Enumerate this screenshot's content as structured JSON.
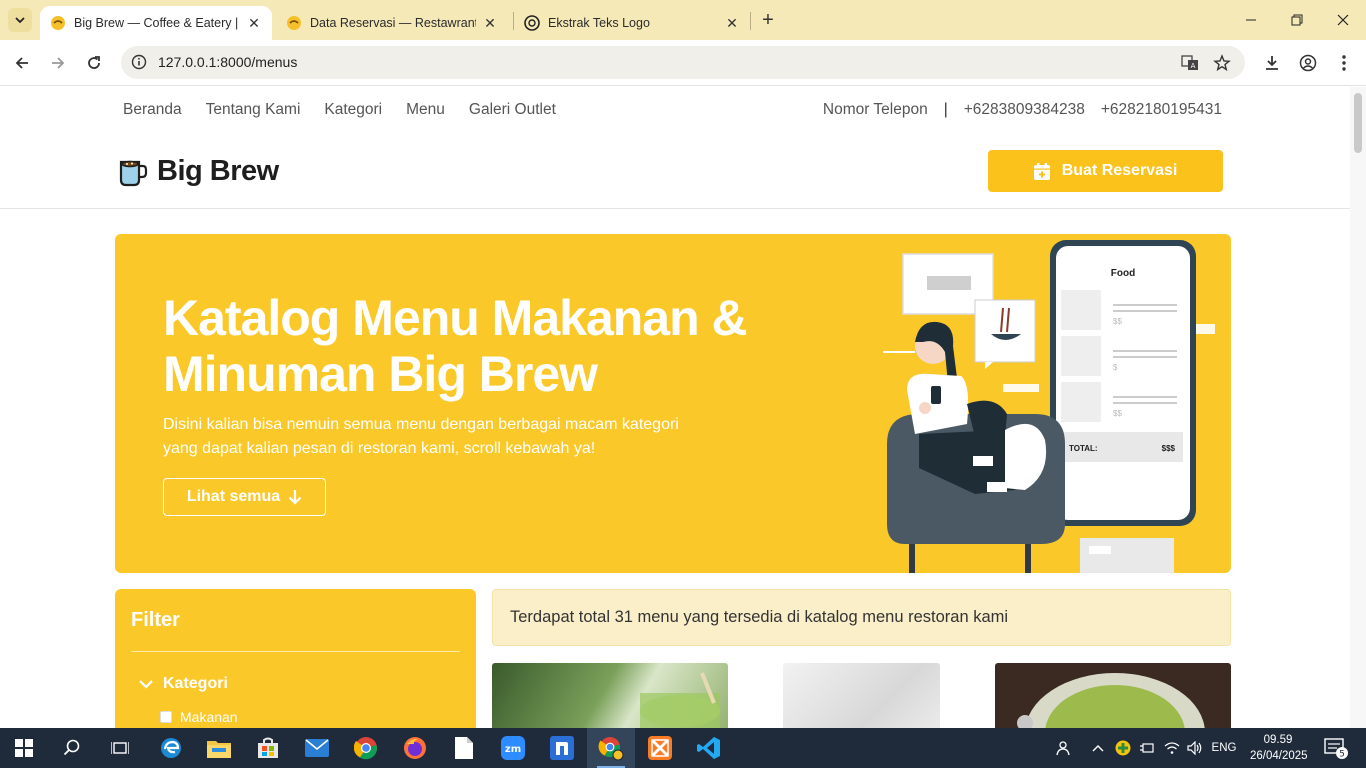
{
  "browser": {
    "tabs": [
      {
        "title": "Big Brew — Coffee & Eatery | R",
        "active": true
      },
      {
        "title": "Data Reservasi — Restawrant",
        "active": false
      },
      {
        "title": "Ekstrak Teks Logo",
        "active": false
      }
    ],
    "url": "127.0.0.1:8000/menus"
  },
  "site": {
    "nav": [
      "Beranda",
      "Tentang Kami",
      "Kategori",
      "Menu",
      "Galeri Outlet"
    ],
    "phone_label": "Nomor Telepon",
    "separator": "|",
    "phones": [
      "+6283809384238",
      "+6282180195431"
    ],
    "brand": "Big Brew",
    "reserve_button": "Buat Reservasi"
  },
  "hero": {
    "title": "Katalog Menu Makanan & Minuman Big Brew",
    "subtitle": "Disini kalian bisa nemuin semua menu dengan berbagai macam kategori yang dapat kalian pesan di restoran kami, scroll kebawah ya!",
    "button": "Lihat semua",
    "illustration": {
      "phone_title": "Food",
      "prices": [
        "$$",
        "$",
        "$$"
      ],
      "total_label": "TOTAL:",
      "total_value": "$$$"
    }
  },
  "filter": {
    "title": "Filter",
    "category_label": "Kategori",
    "items": [
      "Makanan"
    ]
  },
  "notice": "Terdapat total 31 menu yang tersedia di katalog menu restoran kami",
  "taskbar": {
    "language": "ENG",
    "time": "09.59",
    "date": "26/04/2025",
    "notifications": "5"
  },
  "colors": {
    "brand_yellow": "#fbc82a",
    "tab_strip": "#f5e9b8",
    "taskbar": "#1f2b3a"
  }
}
